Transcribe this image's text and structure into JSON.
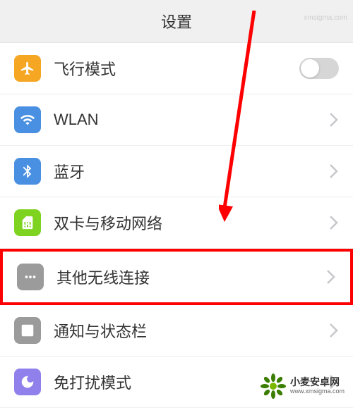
{
  "header": {
    "title": "设置"
  },
  "rows": {
    "airplane": {
      "label": "飞行模式",
      "toggle": false
    },
    "wlan": {
      "label": "WLAN"
    },
    "bluetooth": {
      "label": "蓝牙"
    },
    "sim": {
      "label": "双卡与移动网络"
    },
    "other": {
      "label": "其他无线连接"
    },
    "notification": {
      "label": "通知与状态栏"
    },
    "dnd": {
      "label": "免打扰模式"
    }
  },
  "watermark": {
    "brand": "小麦安卓网",
    "url": "www.xmsigma.com",
    "top": "xmsigma.com"
  }
}
